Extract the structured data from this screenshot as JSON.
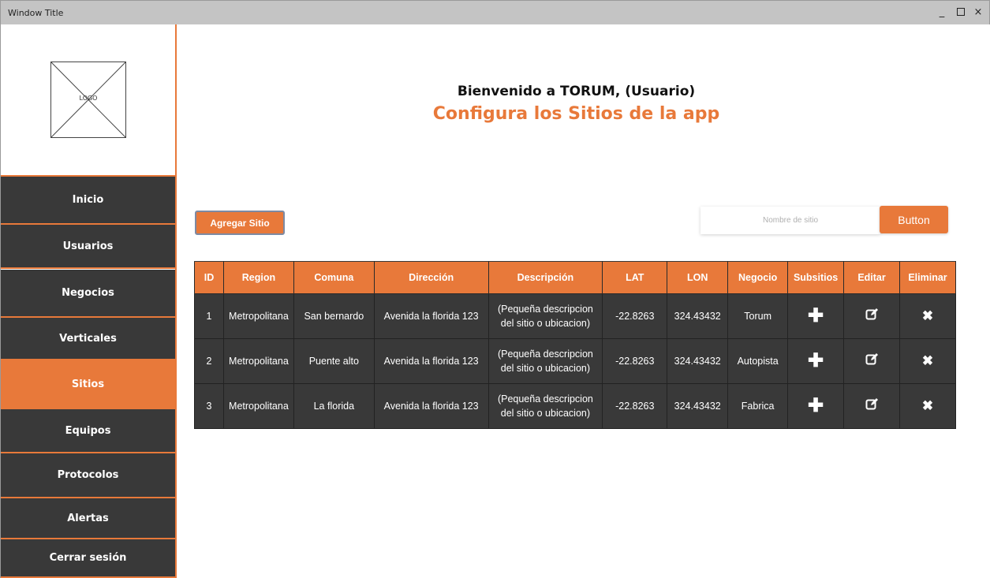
{
  "window": {
    "title": "Window Title",
    "minimize": "_",
    "close": "×"
  },
  "sidebar": {
    "logo_text": "LOGO",
    "items": [
      {
        "label": "Inicio",
        "active": false
      },
      {
        "label": "Usuarios",
        "active": false
      },
      {
        "label": "Negocios",
        "active": false
      },
      {
        "label": "Verticales",
        "active": false
      },
      {
        "label": "Sitios",
        "active": true
      },
      {
        "label": "Equipos",
        "active": false
      },
      {
        "label": "Protocolos",
        "active": false
      },
      {
        "label": "Alertas",
        "active": false
      },
      {
        "label": "Cerrar sesión",
        "active": false
      }
    ]
  },
  "header": {
    "welcome": "Bienvenido a TORUM, (Usuario)",
    "subtitle": "Configura los Sitios de la app"
  },
  "toolbar": {
    "add_label": "Agregar Sitio",
    "search_placeholder": "Nombre de sitio",
    "search_button": "Button"
  },
  "table": {
    "columns": [
      "ID",
      "Region",
      "Comuna",
      "Dirección",
      "Descripción",
      "LAT",
      "LON",
      "Negocio",
      "Subsitios",
      "Editar",
      "Eliminar"
    ],
    "rows": [
      {
        "id": "1",
        "region": "Metropolitana",
        "comuna": "San bernardo",
        "direccion": "Avenida la florida 123",
        "descripcion": "(Pequeña descripcion del sitio o ubicacion)",
        "lat": "-22.8263",
        "lon": "324.43432",
        "negocio": "Torum"
      },
      {
        "id": "2",
        "region": "Metropolitana",
        "comuna": "Puente alto",
        "direccion": "Avenida la florida 123",
        "descripcion": "(Pequeña descripcion del sitio o ubicacion)",
        "lat": "-22.8263",
        "lon": "324.43432",
        "negocio": "Autopista"
      },
      {
        "id": "3",
        "region": "Metropolitana",
        "comuna": "La florida",
        "direccion": "Avenida la florida 123",
        "descripcion": "(Pequeña descripcion del sitio o ubicacion)",
        "lat": "-22.8263",
        "lon": "324.43432",
        "negocio": "Fabrica"
      }
    ],
    "icons": {
      "subsitios": "plus-icon",
      "editar": "edit-icon",
      "eliminar": "close-x-icon"
    }
  },
  "colors": {
    "accent": "#e8793a",
    "sidebar_bg": "#393939",
    "titlebar_bg": "#c4c4c4"
  }
}
